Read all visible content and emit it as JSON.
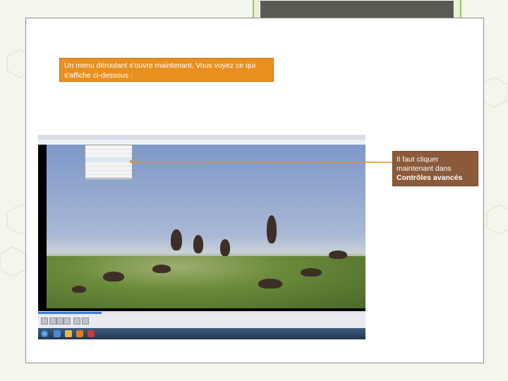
{
  "callouts": {
    "top_text": "Un menu déroulant s'ouvre maintenant. Vous voyez ce qui s'affiche ci-dessous :",
    "right_text_prefix": "Il faut cliquer maintenant dans",
    "right_text_bold": "Contrôles avancés"
  },
  "colors": {
    "callout_top_bg": "#e8901f",
    "callout_right_bg": "#8a5a3a",
    "frame_accent": "#9bc35a"
  },
  "icons": {
    "play": "play-icon",
    "stop": "stop-icon",
    "prev": "previous-icon",
    "next": "next-icon",
    "start": "windows-start-icon"
  }
}
